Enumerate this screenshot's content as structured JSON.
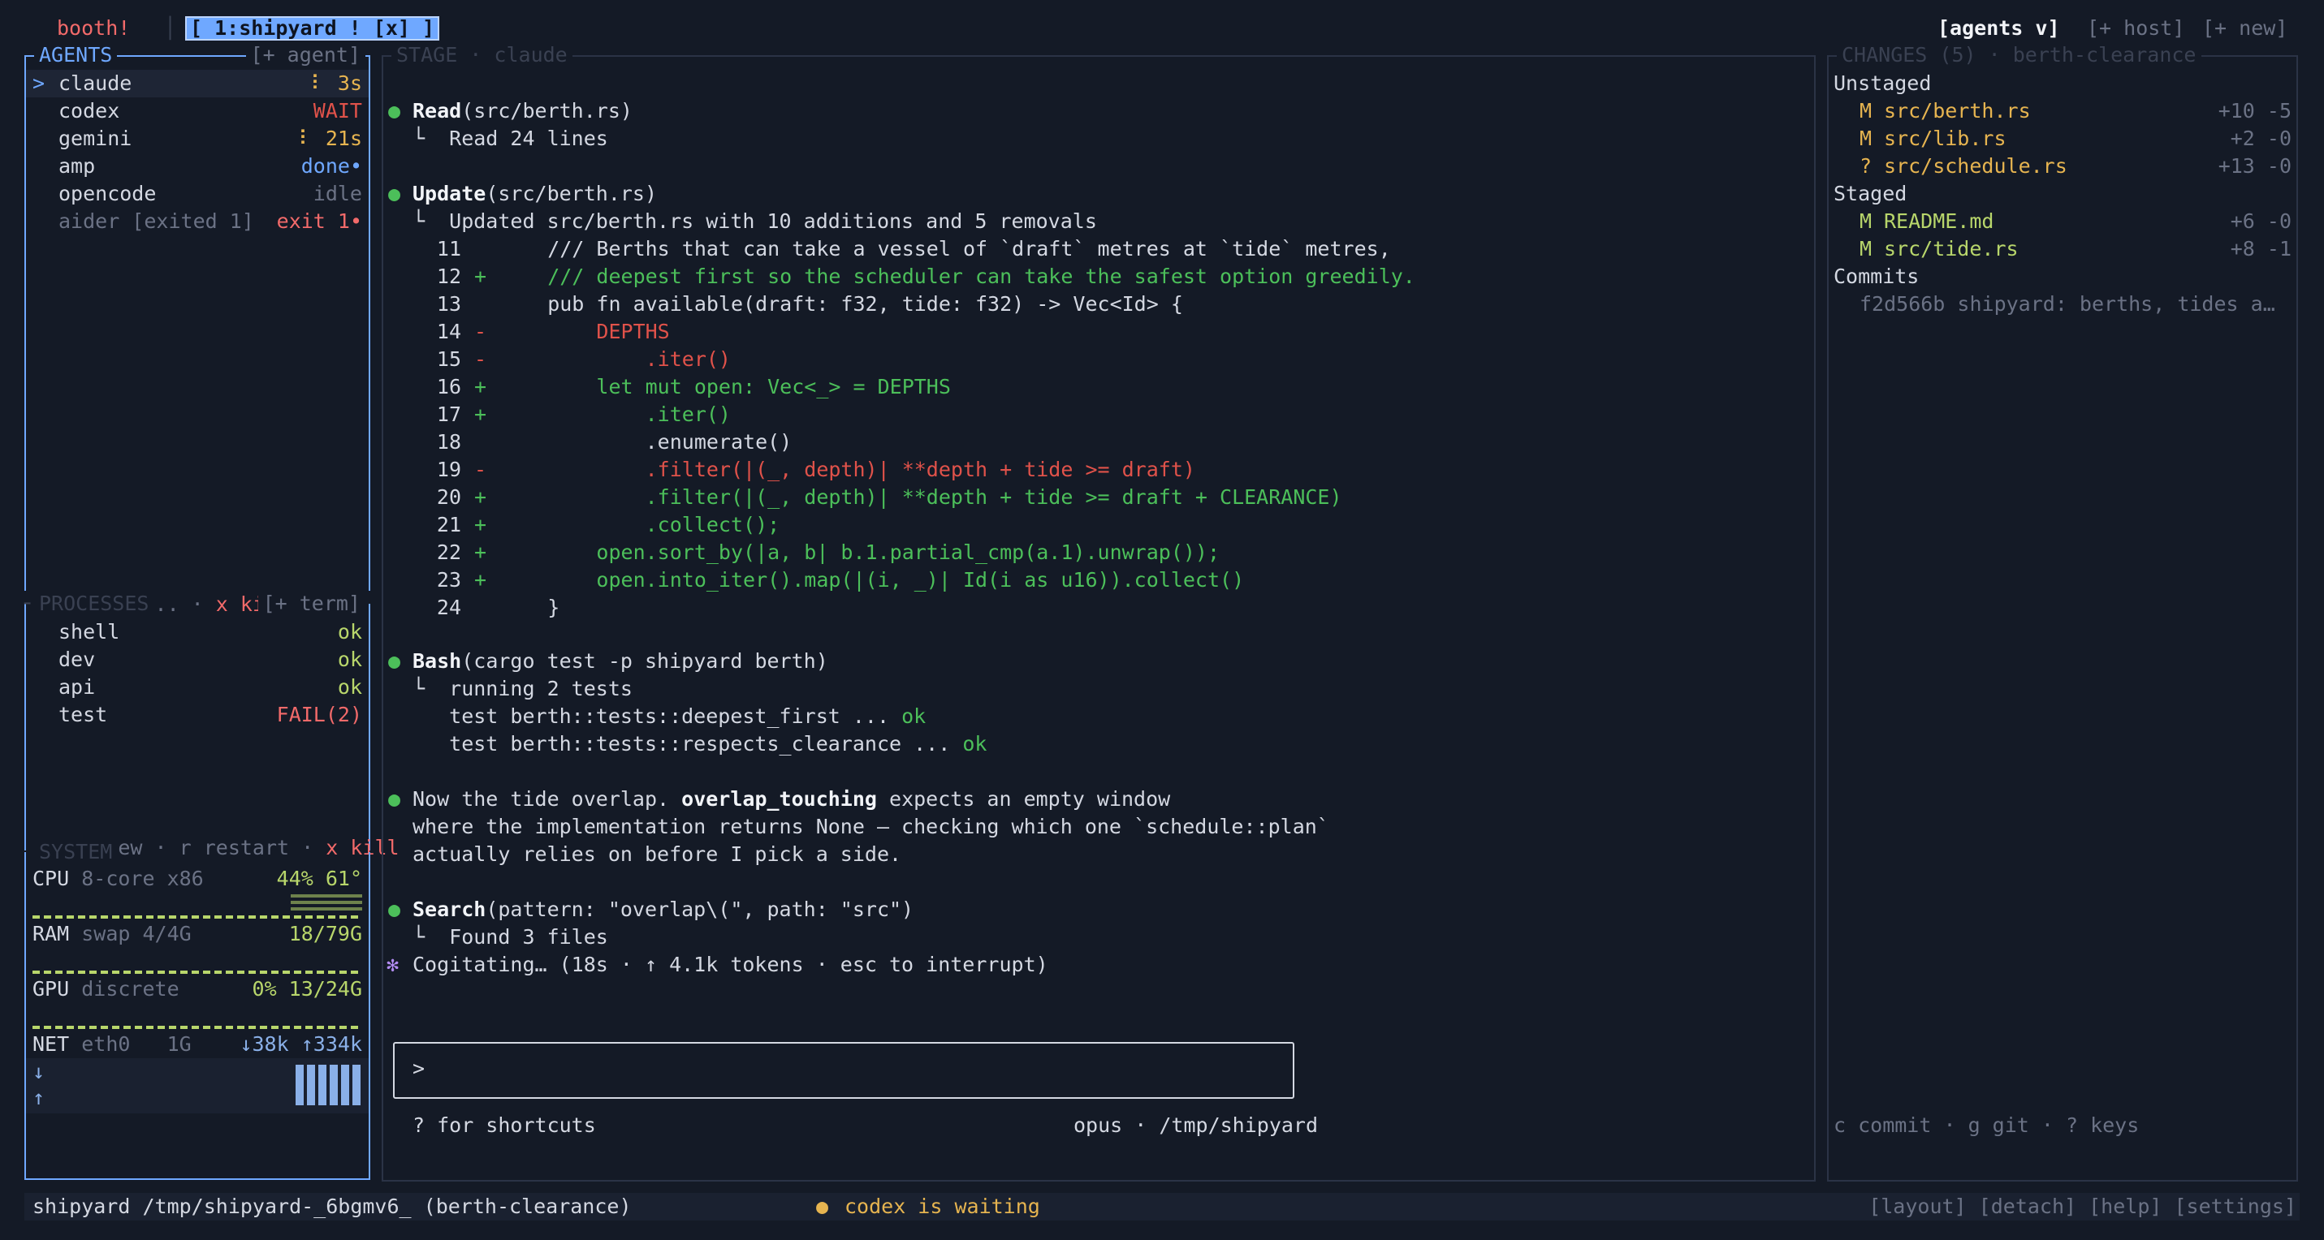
{
  "topbar": {
    "brand": "booth!",
    "tab_label": "[ 1:shipyard ! [x] ]",
    "agents_view": "[agents v]",
    "add_host": "[+ host]",
    "add_new": "[+ new]"
  },
  "agents": {
    "title": "AGENTS",
    "add_label": "[+ agent]",
    "items": [
      {
        "marker": ">",
        "name": "claude",
        "status": "⠇ 3s",
        "status_color": "#e6b450"
      },
      {
        "marker": "",
        "name": "codex",
        "status": "WAIT",
        "status_color": "#e0524a"
      },
      {
        "marker": "",
        "name": "gemini",
        "status": "⠇ 21s",
        "status_color": "#e6b450"
      },
      {
        "marker": "",
        "name": "amp",
        "status": "done•",
        "status_color": "#6fa8ff"
      },
      {
        "marker": "",
        "name": "opencode",
        "status": "idle",
        "status_color": "#6b7285"
      },
      {
        "marker": "",
        "name": "aider [exited 1]",
        "status": "exit 1•",
        "status_color": "#f26a6a"
      }
    ],
    "footer_new": "a new... · ",
    "footer_kill": "x kill"
  },
  "processes": {
    "title": "PROCESSES",
    "add_label": "[+ term]",
    "items": [
      {
        "name": "shell",
        "status": "ok"
      },
      {
        "name": "dev",
        "status": "ok"
      },
      {
        "name": "api",
        "status": "ok"
      },
      {
        "name": "test",
        "status": "FAIL(2)"
      }
    ],
    "footer_a": "t new · r restart · ",
    "footer_kill": "x kill"
  },
  "system": {
    "title": "SYSTEM",
    "cpu_label": "CPU",
    "cpu_detail": "8-core x86",
    "cpu_value": "44% 61°",
    "ram_label": "RAM",
    "ram_detail": "swap 4/4G",
    "ram_value": "18/79G",
    "gpu_label": "GPU",
    "gpu_detail": "discrete",
    "gpu_value": "0% 13/24G",
    "net_label": "NET",
    "net_detail": "eth0   1G",
    "net_down": "↓38k",
    "net_up": "↑334k",
    "down_arrow": "↓",
    "up_arrow": "↑"
  },
  "stage": {
    "title": "STAGE · claude",
    "read_tool": "Read",
    "read_arg": "(src/berth.rs)",
    "read_result": "└  Read 24 lines",
    "update_tool": "Update",
    "update_arg": "(src/berth.rs)",
    "update_result": "└  Updated src/berth.rs with 10 additions and 5 removals",
    "diff": [
      {
        "n": "11",
        "s": " ",
        "t": "    /// Berths that can take a vessel of `draft` metres at `tide` metres,",
        "k": "ctx"
      },
      {
        "n": "12",
        "s": "+",
        "t": "    /// deepest first so the scheduler can take the safest option greedily.",
        "k": "add"
      },
      {
        "n": "13",
        "s": " ",
        "t": "    pub fn available(draft: f32, tide: f32) -> Vec<Id> {",
        "k": "ctx"
      },
      {
        "n": "14",
        "s": "-",
        "t": "        DEPTHS",
        "k": "del"
      },
      {
        "n": "15",
        "s": "-",
        "t": "            .iter()",
        "k": "del"
      },
      {
        "n": "16",
        "s": "+",
        "t": "        let mut open: Vec<_> = DEPTHS",
        "k": "add"
      },
      {
        "n": "17",
        "s": "+",
        "t": "            .iter()",
        "k": "add"
      },
      {
        "n": "18",
        "s": " ",
        "t": "            .enumerate()",
        "k": "ctx"
      },
      {
        "n": "19",
        "s": "-",
        "t": "            .filter(|(_, depth)| **depth + tide >= draft)",
        "k": "del"
      },
      {
        "n": "20",
        "s": "+",
        "t": "            .filter(|(_, depth)| **depth + tide >= draft + CLEARANCE)",
        "k": "add"
      },
      {
        "n": "21",
        "s": "+",
        "t": "            .collect();",
        "k": "add"
      },
      {
        "n": "22",
        "s": "+",
        "t": "        open.sort_by(|a, b| b.1.partial_cmp(a.1).unwrap());",
        "k": "add"
      },
      {
        "n": "23",
        "s": "+",
        "t": "        open.into_iter().map(|(i, _)| Id(i as u16)).collect()",
        "k": "add"
      },
      {
        "n": "24",
        "s": " ",
        "t": "    }",
        "k": "ctx"
      }
    ],
    "bash_tool": "Bash",
    "bash_arg": "(cargo test -p shipyard berth)",
    "bash_result": "└  running 2 tests",
    "test1": "   test berth::tests::deepest_first ... ",
    "test2": "   test berth::tests::respects_clearance ... ",
    "test_ok": "ok",
    "msg_pre": "Now the tide overlap. ",
    "msg_bold": "overlap_touching",
    "msg_post": " expects an empty window",
    "msg_line2": "where the implementation returns None — checking which one `schedule::plan`",
    "msg_line3": "actually relies on before I pick a side.",
    "search_tool": "Search",
    "search_arg": "(pattern: \"overlap\\(\", path: \"src\")",
    "search_result": "└  Found 3 files",
    "spinner": "✻",
    "cogitating": "Cogitating… (18s · ↑ 4.1k tokens · esc to interrupt)",
    "prompt_symbol": ">",
    "shortcuts": "? for shortcuts",
    "model_path": "opus · /tmp/shipyard"
  },
  "changes": {
    "title": "CHANGES (5) · berth-clearance",
    "unstaged_label": "Unstaged",
    "unstaged": [
      {
        "mark": "M",
        "file": "src/berth.rs",
        "diff": "+10 -5"
      },
      {
        "mark": "M",
        "file": "src/lib.rs",
        "diff": "+2 -0"
      },
      {
        "mark": "?",
        "file": "src/schedule.rs",
        "diff": "+13 -0"
      }
    ],
    "staged_label": "Staged",
    "staged": [
      {
        "mark": "M",
        "file": "README.md",
        "diff": "+6 -0"
      },
      {
        "mark": "M",
        "file": "src/tide.rs",
        "diff": "+8 -1"
      }
    ],
    "commits_label": "Commits",
    "commit": "f2d566b shipyard: berths, tides a…",
    "footer": "c commit · g git · ? keys"
  },
  "statusbar": {
    "left": "shipyard /tmp/shipyard-_6bgmv6_ (berth-clearance)",
    "dot": "●",
    "waiting": "codex is waiting",
    "right": "[layout] [detach] [help] [settings]"
  },
  "colors": {
    "background": "#141a26",
    "accent_blue": "#6fa8ff",
    "green": "#4cbf5a",
    "red": "#e0524a",
    "yellow": "#e6b450"
  }
}
